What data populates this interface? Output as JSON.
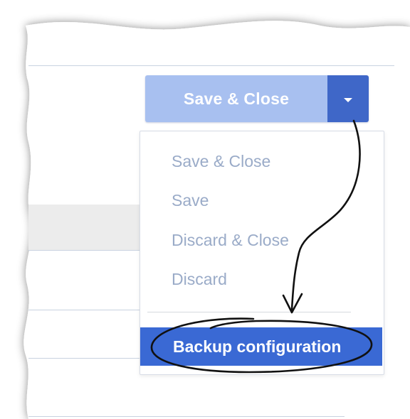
{
  "toolbar": {
    "save_close_label": "Save & Close",
    "colors": {
      "button_main": "#a8c0f0",
      "button_toggle": "#3f67c8"
    }
  },
  "menu": {
    "items": [
      {
        "label": "Save & Close"
      },
      {
        "label": "Save"
      },
      {
        "label": "Discard & Close"
      },
      {
        "label": "Discard"
      }
    ],
    "highlighted": {
      "label": "Backup configuration"
    },
    "colors": {
      "item_text": "#9aabc8",
      "highlight": "#3a69d4"
    }
  },
  "annotation": {
    "icons": [
      "curved-arrow-icon",
      "hand-drawn-ellipse-icon"
    ]
  }
}
